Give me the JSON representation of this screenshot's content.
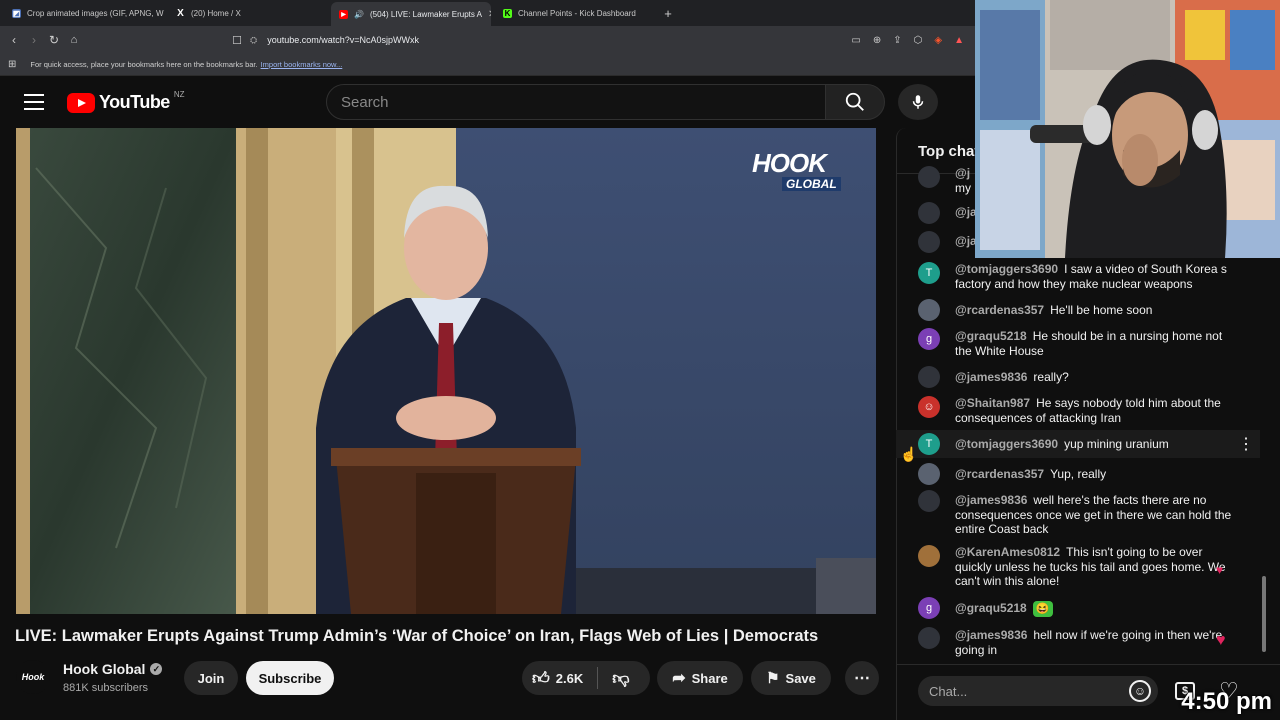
{
  "browser": {
    "tabs": [
      {
        "label": "Crop animated images (GIF, APNG, W",
        "fav_color": "#4b6fb3",
        "fav_glyph": "◩"
      },
      {
        "label": "(20) Home / X",
        "fav_color": "#000000",
        "fav_glyph": "X"
      },
      {
        "label": "(504) LIVE: Lawmaker Erupts A",
        "fav_color": "#ff0000",
        "fav_glyph": "▶"
      },
      {
        "label": "Channel Points - Kick Dashboard",
        "fav_color": "#53fc18",
        "fav_glyph": "K"
      }
    ],
    "url": "youtube.com/watch?v=NcA0sjpWWxk",
    "bookmarks_msg": "For quick access, place your bookmarks here on the bookmarks bar.",
    "import_link": "Import bookmarks now..."
  },
  "youtube": {
    "logo_text": "YouTube",
    "country": "NZ",
    "search_placeholder": "Search"
  },
  "video": {
    "watermark_top": "HOOK",
    "watermark_bottom": "GLOBAL",
    "title": "LIVE: Lawmaker Erupts Against Trump Admin’s ‘War of Choice’ on Iran, Flags Web of Lies | Democrats",
    "channel_avatar": "Hook",
    "channel_name": "Hook Global",
    "subscribers": "881K subscribers",
    "join": "Join",
    "subscribe": "Subscribe",
    "likes": "2.6K",
    "share": "Share",
    "save": "Save"
  },
  "chat": {
    "header": "Top chat",
    "partial_top": [
      {
        "author": "@j",
        "text": "my"
      },
      {
        "author": "@ja",
        "text": ""
      },
      {
        "author": "@ja",
        "text": ""
      }
    ],
    "messages": [
      {
        "author": "@tomjaggers3690",
        "text": "I saw a video of South Korea s factory and how they make nuclear weapons",
        "avatar": "T",
        "color": "#1e9e8c"
      },
      {
        "author": "@rcardenas357",
        "text": "He'll be home soon",
        "avatar": "",
        "color": "#5a6270"
      },
      {
        "author": "@graqu5218",
        "text": "He should be in a nursing home not the White House",
        "avatar": "g",
        "color": "#7b3fb5"
      },
      {
        "author": "@james9836",
        "text": "really?",
        "avatar": "",
        "color": "#30333a"
      },
      {
        "author": "@Shaitan987",
        "text": "He says nobody told him about the consequences of attacking Iran",
        "avatar": "☺",
        "color": "#c9312b"
      },
      {
        "author": "@tomjaggers3690",
        "text": "yup mining uranium",
        "avatar": "T",
        "color": "#1e9e8c"
      },
      {
        "author": "@rcardenas357",
        "text": "Yup, really",
        "avatar": "",
        "color": "#5a6270"
      },
      {
        "author": "@james9836",
        "text": "well here's the facts there are no consequences once we get in there we can hold the entire Coast back",
        "avatar": "",
        "color": "#30333a"
      },
      {
        "author": "@KarenAmes0812",
        "text": "This isn't going to be over quickly unless he tucks his tail and goes home. We can't win this alone!",
        "avatar": "",
        "color": "#a0703a"
      },
      {
        "author": "@graqu5218",
        "text": "",
        "avatar": "g",
        "color": "#7b3fb5"
      },
      {
        "author": "@james9836",
        "text": "hell now if we're going in then we're going in",
        "avatar": "",
        "color": "#30333a"
      }
    ],
    "input_placeholder": "Chat..."
  },
  "overlay": {
    "clock": "4:50 pm"
  }
}
